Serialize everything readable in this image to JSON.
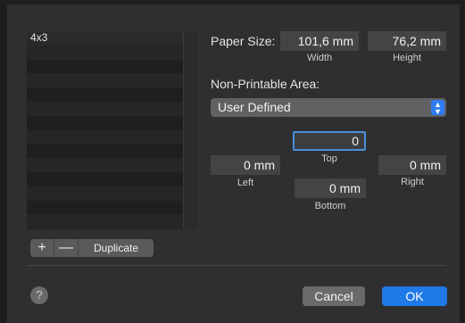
{
  "list": {
    "items": [
      {
        "label": "4x3"
      },
      {
        "label": ""
      },
      {
        "label": ""
      },
      {
        "label": ""
      },
      {
        "label": ""
      },
      {
        "label": ""
      },
      {
        "label": ""
      },
      {
        "label": ""
      },
      {
        "label": ""
      },
      {
        "label": ""
      },
      {
        "label": ""
      },
      {
        "label": ""
      },
      {
        "label": ""
      },
      {
        "label": ""
      }
    ]
  },
  "list_controls": {
    "plus_label": "+",
    "minus_label": "—",
    "duplicate_label": "Duplicate"
  },
  "paper_size": {
    "label": "Paper Size:",
    "width_value": "101,6 mm",
    "width_caption": "Width",
    "height_value": "76,2 mm",
    "height_caption": "Height"
  },
  "non_printable": {
    "label": "Non-Printable Area:",
    "selected": "User Defined",
    "top_value": "0",
    "top_caption": "Top",
    "left_value": "0 mm",
    "left_caption": "Left",
    "right_value": "0 mm",
    "right_caption": "Right",
    "bottom_value": "0 mm",
    "bottom_caption": "Bottom"
  },
  "footer": {
    "help_label": "?",
    "cancel_label": "Cancel",
    "ok_label": "OK"
  },
  "colors": {
    "accent": "#1f79e6",
    "focus_ring": "#4a90d9",
    "background": "#2f2f31"
  }
}
